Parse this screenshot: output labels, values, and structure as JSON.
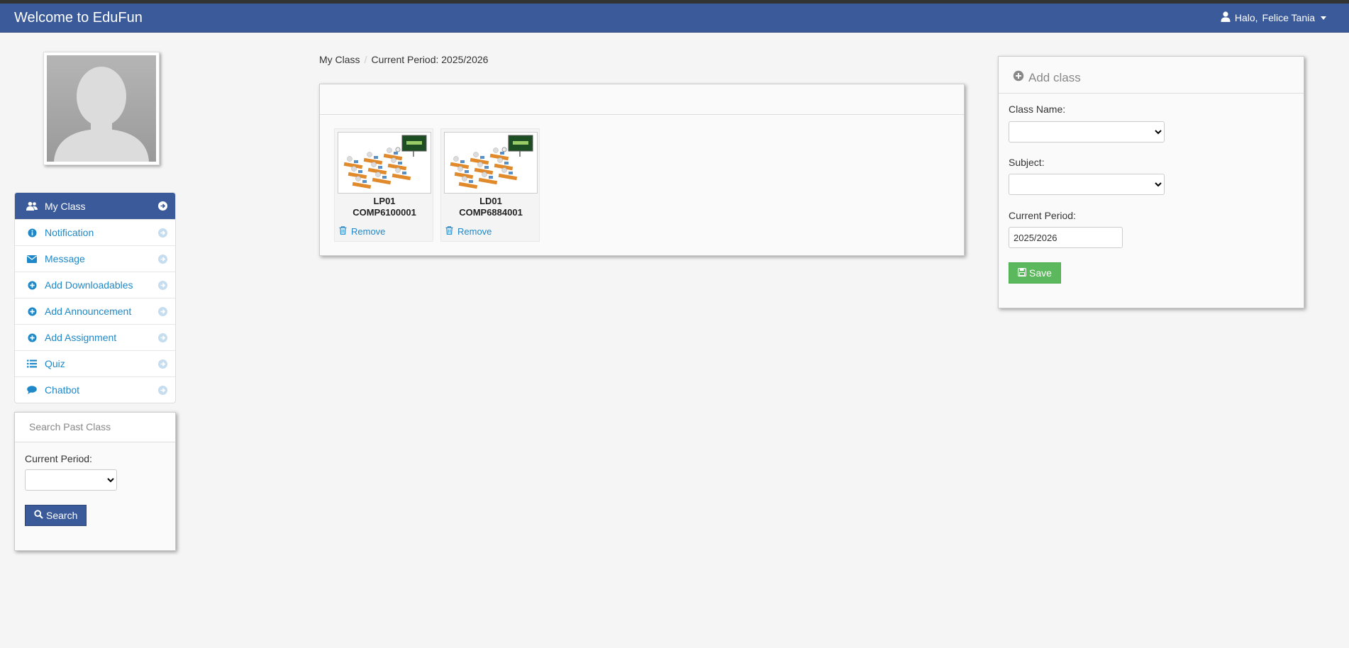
{
  "navbar": {
    "brand": "Welcome to EduFun",
    "greeting": "Halo,",
    "user_name": "Felice Tania"
  },
  "sidebar": {
    "menu": [
      {
        "label": "My Class",
        "icon": "users-icon",
        "active": true
      },
      {
        "label": "Notification",
        "icon": "info-icon",
        "active": false
      },
      {
        "label": "Message",
        "icon": "envelope-icon",
        "active": false
      },
      {
        "label": "Add Downloadables",
        "icon": "plus-circle-icon",
        "active": false
      },
      {
        "label": "Add Announcement",
        "icon": "plus-circle-icon",
        "active": false
      },
      {
        "label": "Add Assignment",
        "icon": "plus-circle-icon",
        "active": false
      },
      {
        "label": "Quiz",
        "icon": "list-icon",
        "active": false
      },
      {
        "label": "Chatbot",
        "icon": "comment-icon",
        "active": false
      }
    ],
    "search_panel": {
      "title": "Search Past Class",
      "period_label": "Current Period:",
      "period_value": "",
      "search_button": "Search"
    }
  },
  "breadcrumb": {
    "home": "My Class",
    "current": "Current Period: 2025/2026"
  },
  "classes": [
    {
      "code": "LP01",
      "course": "COMP6100001",
      "remove_label": "Remove"
    },
    {
      "code": "LD01",
      "course": "COMP6884001",
      "remove_label": "Remove"
    }
  ],
  "add_class": {
    "title": "Add class",
    "class_name_label": "Class Name:",
    "class_name_value": "",
    "subject_label": "Subject:",
    "subject_value": "",
    "period_label": "Current Period:",
    "period_value": "2025/2026",
    "save_button": "Save"
  },
  "colors": {
    "navbar": "#3b5a9a",
    "link": "#1e88c8",
    "save": "#5cb85c",
    "background": "#f5f5f5"
  }
}
